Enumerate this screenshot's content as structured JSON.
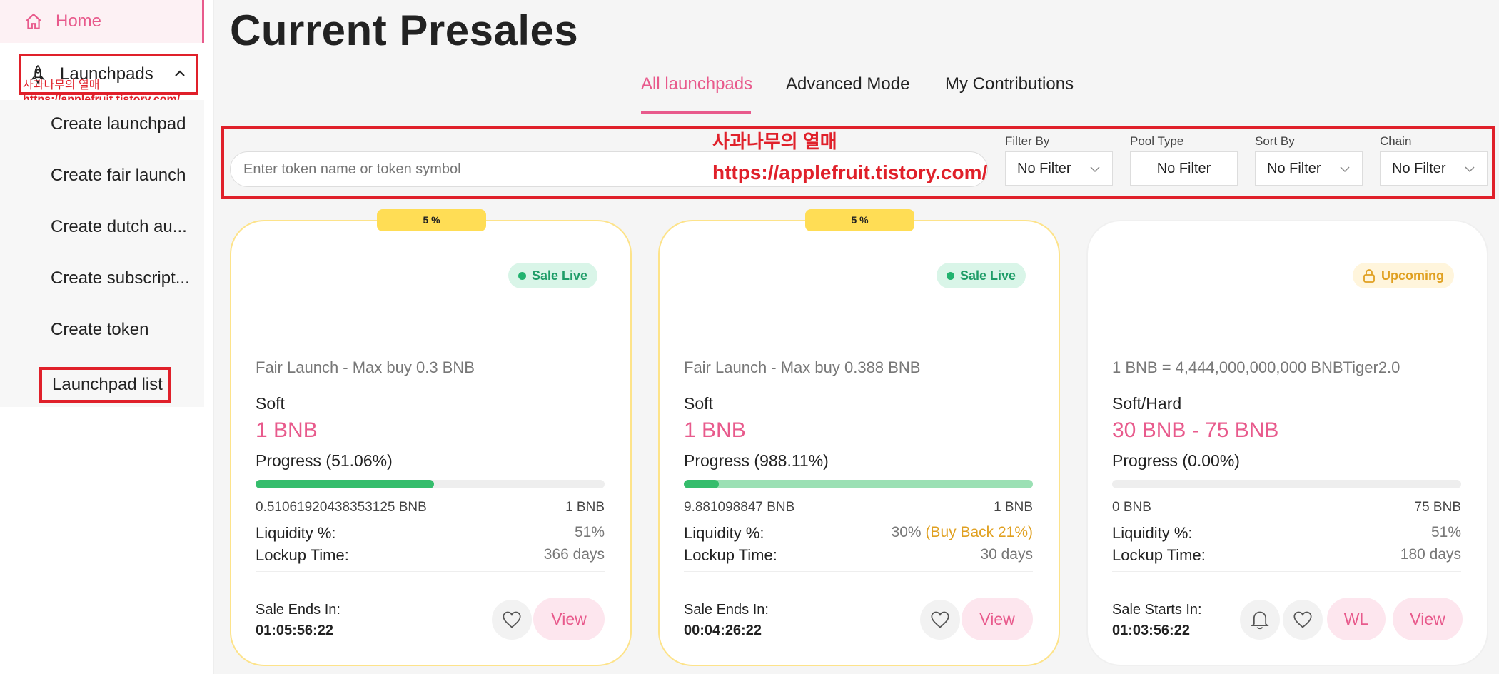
{
  "sidebar": {
    "home": "Home",
    "launchpads": "Launchpads",
    "watermark_line1": "사과나무의 열매",
    "watermark_line2": "https://applefruit.tistory.com/",
    "items": [
      "Create launchpad",
      "Create fair launch",
      "Create dutch au...",
      "Create subscript...",
      "Create token",
      "Launchpad list"
    ]
  },
  "page_title": "Current Presales",
  "tabs": [
    "All launchpads",
    "Advanced Mode",
    "My Contributions"
  ],
  "search": {
    "placeholder": "Enter token name or token symbol"
  },
  "watermark": {
    "line1": "사과나무의 열매",
    "line2": "https://applefruit.tistory.com/"
  },
  "filters": [
    {
      "label": "Filter By",
      "value": "No Filter"
    },
    {
      "label": "Pool Type",
      "value": "No Filter"
    },
    {
      "label": "Sort By",
      "value": "No Filter"
    },
    {
      "label": "Chain",
      "value": "No Filter"
    }
  ],
  "cards": [
    {
      "badge": "5 %",
      "status": "Sale Live",
      "subtitle": "Fair Launch - Max buy 0.3 BNB",
      "cap_label": "Soft",
      "cap_value": "1 BNB",
      "progress_label": "Progress (51.06%)",
      "progress_fraction": 0.5106,
      "raised": "0.51061920438353125 BNB",
      "max": "1 BNB",
      "liquidity_label": "Liquidity %:",
      "liquidity_value": "51%",
      "lockup_label": "Lockup Time:",
      "lockup_value": "366 days",
      "end_label": "Sale Ends In:",
      "end_time": "01:05:56:22",
      "view": "View"
    },
    {
      "badge": "5 %",
      "status": "Sale Live",
      "subtitle": "Fair Launch - Max buy 0.388 BNB",
      "cap_label": "Soft",
      "cap_value": "1 BNB",
      "progress_label": "Progress (988.11%)",
      "progress_fraction": 0.1,
      "raised": "9.881098847 BNB",
      "max": "1 BNB",
      "liquidity_label": "Liquidity %:",
      "liquidity_value": "30%",
      "liquidity_extra": "(Buy Back 21%)",
      "lockup_label": "Lockup Time:",
      "lockup_value": "30 days",
      "end_label": "Sale Ends In:",
      "end_time": "00:04:26:22",
      "view": "View"
    },
    {
      "status": "Upcoming",
      "subtitle": "1 BNB = 4,444,000,000,000 BNBTiger2.0",
      "cap_label": "Soft/Hard",
      "cap_value": "30 BNB - 75 BNB",
      "progress_label": "Progress (0.00%)",
      "progress_fraction": 0,
      "raised": "0 BNB",
      "max": "75 BNB",
      "liquidity_label": "Liquidity %:",
      "liquidity_value": "51%",
      "lockup_label": "Lockup Time:",
      "lockup_value": "180 days",
      "end_label": "Sale Starts In:",
      "end_time": "01:03:56:22",
      "wl": "WL",
      "view": "View"
    }
  ],
  "colors": {
    "accent": "#e85a8c",
    "highlight_box": "#e0202a",
    "progress": "#35bd6c",
    "badge": "#ffdd55"
  },
  "icons": [
    "home-icon",
    "rocket-icon",
    "chevron-up-icon",
    "chevron-down-icon",
    "heart-icon",
    "bell-icon",
    "lock-icon"
  ]
}
